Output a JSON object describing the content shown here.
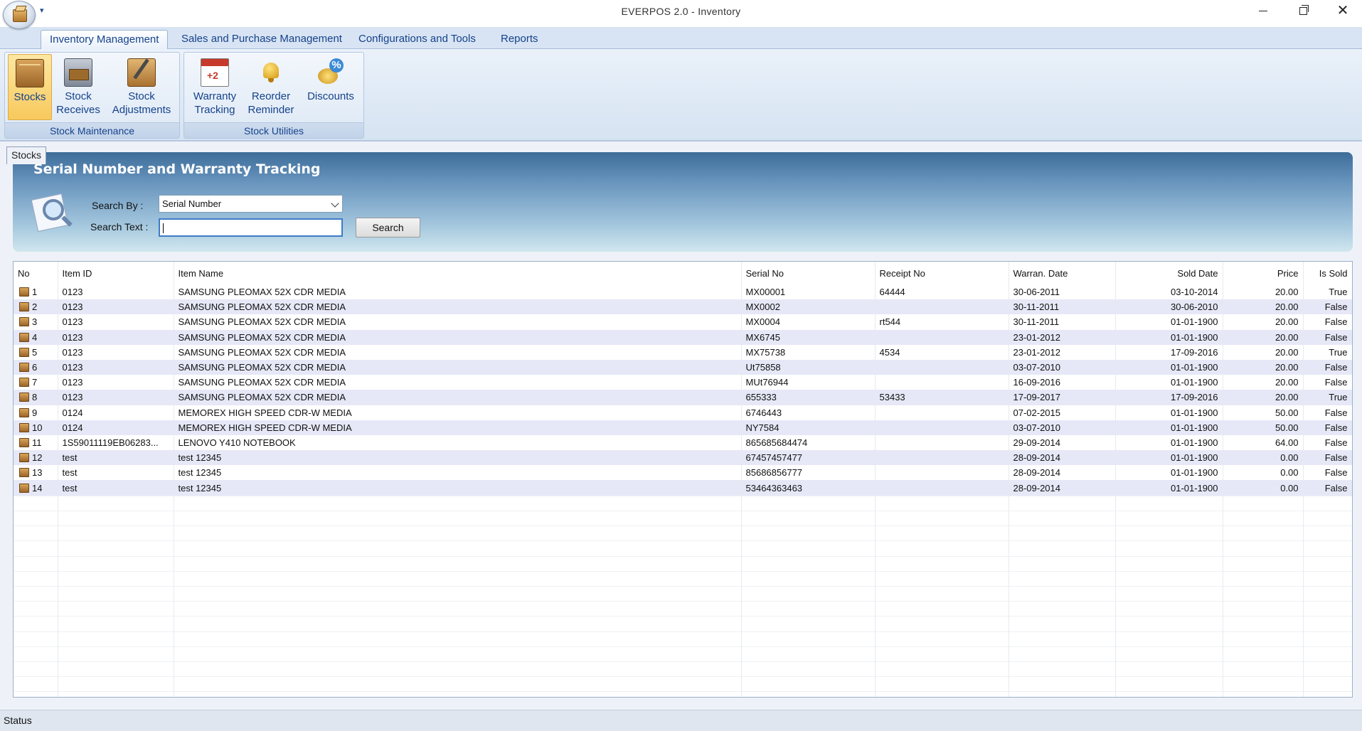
{
  "window": {
    "title": "EVERPOS 2.0 - Inventory",
    "minimize": "—",
    "maximize": "❐",
    "close": "✕"
  },
  "ribbon": {
    "tabs": [
      {
        "label": "Inventory Management",
        "active": true
      },
      {
        "label": "Sales and Purchase Management"
      },
      {
        "label": "Configurations and Tools"
      },
      {
        "label": "Reports"
      }
    ],
    "groups": [
      {
        "label": "Stock Maintenance",
        "buttons": [
          {
            "label": "Stocks",
            "icon": "box-icon",
            "active": true
          },
          {
            "label": "Stock Receives",
            "icon": "truck-icon"
          },
          {
            "label": "Stock Adjustments",
            "icon": "edit-box-icon"
          }
        ]
      },
      {
        "label": "Stock Utilities",
        "buttons": [
          {
            "label": "Warranty Tracking",
            "icon": "calendar-icon"
          },
          {
            "label": "Reorder Reminder",
            "icon": "bell-icon"
          },
          {
            "label": "Discounts",
            "icon": "coins-icon"
          }
        ]
      }
    ]
  },
  "document_tab": "Stocks",
  "panel": {
    "title": "Serial Number and Warranty Tracking",
    "search_by_label": "Search By :",
    "search_by_value": "Serial Number",
    "search_text_label": "Search Text :",
    "search_text_value": "",
    "search_button": "Search"
  },
  "grid": {
    "columns": [
      "No",
      "Item ID",
      "Item Name",
      "Serial No",
      "Receipt No",
      "Warran. Date",
      "Sold Date",
      "Price",
      "Is Sold"
    ],
    "rows": [
      [
        "1",
        "0123",
        "SAMSUNG PLEOMAX 52X CDR MEDIA",
        "MX00001",
        "64444",
        "30-06-2011",
        "03-10-2014",
        "20.00",
        "True"
      ],
      [
        "2",
        "0123",
        "SAMSUNG PLEOMAX 52X CDR MEDIA",
        "MX0002",
        "",
        "30-11-2011",
        "30-06-2010",
        "20.00",
        "False"
      ],
      [
        "3",
        "0123",
        "SAMSUNG PLEOMAX 52X CDR MEDIA",
        "MX0004",
        "rt544",
        "30-11-2011",
        "01-01-1900",
        "20.00",
        "False"
      ],
      [
        "4",
        "0123",
        "SAMSUNG PLEOMAX 52X CDR MEDIA",
        "MX6745",
        "",
        "23-01-2012",
        "01-01-1900",
        "20.00",
        "False"
      ],
      [
        "5",
        "0123",
        "SAMSUNG PLEOMAX 52X CDR MEDIA",
        "MX75738",
        "4534",
        "23-01-2012",
        "17-09-2016",
        "20.00",
        "True"
      ],
      [
        "6",
        "0123",
        "SAMSUNG PLEOMAX 52X CDR MEDIA",
        "Ut75858",
        "",
        "03-07-2010",
        "01-01-1900",
        "20.00",
        "False"
      ],
      [
        "7",
        "0123",
        "SAMSUNG PLEOMAX 52X CDR MEDIA",
        "MUt76944",
        "",
        "16-09-2016",
        "01-01-1900",
        "20.00",
        "False"
      ],
      [
        "8",
        "0123",
        "SAMSUNG PLEOMAX 52X CDR MEDIA",
        "655333",
        "53433",
        "17-09-2017",
        "17-09-2016",
        "20.00",
        "True"
      ],
      [
        "9",
        "0124",
        "MEMOREX HIGH SPEED CDR-W MEDIA",
        "6746443",
        "",
        "07-02-2015",
        "01-01-1900",
        "50.00",
        "False"
      ],
      [
        "10",
        "0124",
        "MEMOREX HIGH SPEED CDR-W MEDIA",
        "NY7584",
        "",
        "03-07-2010",
        "01-01-1900",
        "50.00",
        "False"
      ],
      [
        "11",
        "1S59011119EB06283...",
        "LENOVO Y410 NOTEBOOK",
        "865685684474",
        "",
        "29-09-2014",
        "01-01-1900",
        "64.00",
        "False"
      ],
      [
        "12",
        "test",
        "test 12345",
        "67457457477",
        "",
        "28-09-2014",
        "01-01-1900",
        "0.00",
        "False"
      ],
      [
        "13",
        "test",
        "test 12345",
        "85686856777",
        "",
        "28-09-2014",
        "01-01-1900",
        "0.00",
        "False"
      ],
      [
        "14",
        "test",
        "test 12345",
        "53464363463",
        "",
        "28-09-2014",
        "01-01-1900",
        "0.00",
        "False"
      ]
    ]
  },
  "statusbar": {
    "text": "Status"
  }
}
